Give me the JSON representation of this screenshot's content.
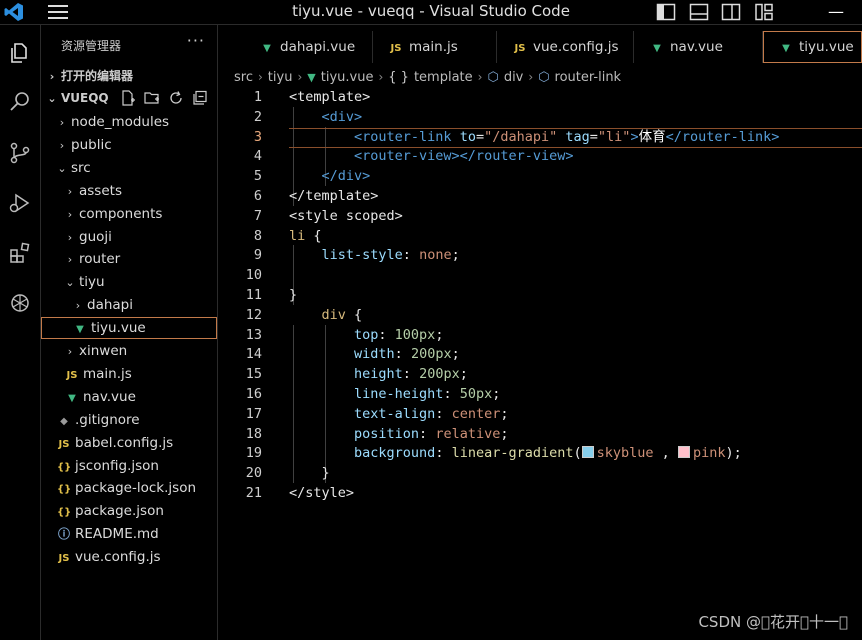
{
  "window": {
    "title": "tiyu.vue - vueqq - Visual Studio Code",
    "minimize_glyph": "—"
  },
  "explorer": {
    "title": "资源管理器",
    "more": "···",
    "open_editors": "打开的编辑器",
    "project": "VUEQQ",
    "items": [
      {
        "label": "node_modules",
        "kind": "folder",
        "expanded": false,
        "depth": 0
      },
      {
        "label": "public",
        "kind": "folder",
        "expanded": false,
        "depth": 0
      },
      {
        "label": "src",
        "kind": "folder",
        "expanded": true,
        "depth": 0
      },
      {
        "label": "assets",
        "kind": "folder",
        "expanded": false,
        "depth": 1
      },
      {
        "label": "components",
        "kind": "folder",
        "expanded": false,
        "depth": 1
      },
      {
        "label": "guoji",
        "kind": "folder",
        "expanded": false,
        "depth": 1
      },
      {
        "label": "router",
        "kind": "folder",
        "expanded": false,
        "depth": 1
      },
      {
        "label": "tiyu",
        "kind": "folder",
        "expanded": true,
        "depth": 1
      },
      {
        "label": "dahapi",
        "kind": "folder",
        "expanded": false,
        "depth": 2
      },
      {
        "label": "tiyu.vue",
        "kind": "vue",
        "depth": 2,
        "selected": true
      },
      {
        "label": "xinwen",
        "kind": "folder",
        "expanded": false,
        "depth": 1
      },
      {
        "label": "main.js",
        "kind": "js",
        "depth": 1
      },
      {
        "label": "nav.vue",
        "kind": "vue",
        "depth": 1
      },
      {
        "label": ".gitignore",
        "kind": "git",
        "depth": 0
      },
      {
        "label": "babel.config.js",
        "kind": "js",
        "depth": 0
      },
      {
        "label": "jsconfig.json",
        "kind": "json",
        "depth": 0
      },
      {
        "label": "package-lock.json",
        "kind": "json",
        "depth": 0
      },
      {
        "label": "package.json",
        "kind": "json",
        "depth": 0
      },
      {
        "label": "README.md",
        "kind": "info",
        "depth": 0
      },
      {
        "label": "vue.config.js",
        "kind": "js",
        "depth": 0
      }
    ]
  },
  "tabs": [
    {
      "label": "dahapi.vue",
      "kind": "vue"
    },
    {
      "label": "main.js",
      "kind": "js"
    },
    {
      "label": "vue.config.js",
      "kind": "js"
    },
    {
      "label": "nav.vue",
      "kind": "vue"
    },
    {
      "label": "tiyu.vue",
      "kind": "vue",
      "active": true
    }
  ],
  "icon_glyphs": {
    "js": "JS",
    "json": "{}",
    "vue": "▼",
    "info": "ⓘ",
    "git": "◆",
    "chevron_right": "›",
    "chevron_down": "⌄"
  },
  "breadcrumbs": [
    "src",
    "tiyu",
    "tiyu.vue",
    "template",
    "div",
    "router-link"
  ],
  "breadcrumb_prefix": {
    "template": "{ }",
    "vue": "▼",
    "tag": "⬡"
  },
  "editor": {
    "active_line": 3,
    "colors": {
      "skyblue": "#87ceeb",
      "pink": "#ffc0cb"
    },
    "lines": [
      [
        [
          "tagw",
          "<template>"
        ]
      ],
      [
        [
          "tag",
          "    <div>"
        ]
      ],
      [
        [
          "tag",
          "        <router-link "
        ],
        [
          "attr",
          "to"
        ],
        [
          "tagw",
          "="
        ],
        [
          "str",
          "\"/dahapi\""
        ],
        [
          "tag",
          " "
        ],
        [
          "attr",
          "tag"
        ],
        [
          "tagw",
          "="
        ],
        [
          "str",
          "\"li\""
        ],
        [
          "tag",
          ">"
        ],
        [
          "txt",
          "体育"
        ],
        [
          "tag",
          "</router-link>"
        ]
      ],
      [
        [
          "tag",
          "        <router-view></router-view>"
        ]
      ],
      [
        [
          "tag",
          "    </div>"
        ]
      ],
      [
        [
          "tagw",
          "</template>"
        ]
      ],
      [
        [
          "tagw",
          "<style scoped>"
        ]
      ],
      [
        [
          "sel",
          "li"
        ],
        [
          "tagw",
          " {"
        ]
      ],
      [
        [
          "prop",
          "    list-style"
        ],
        [
          "tagw",
          ": "
        ],
        [
          "val",
          "none"
        ],
        [
          "tagw",
          ";"
        ]
      ],
      [
        [
          "tagw",
          ""
        ]
      ],
      [
        [
          "tagw",
          "}"
        ]
      ],
      [
        [
          "sel",
          "    div"
        ],
        [
          "tagw",
          " {"
        ]
      ],
      [
        [
          "prop",
          "        top"
        ],
        [
          "tagw",
          ": "
        ],
        [
          "num",
          "100px"
        ],
        [
          "tagw",
          ";"
        ]
      ],
      [
        [
          "prop",
          "        width"
        ],
        [
          "tagw",
          ": "
        ],
        [
          "num",
          "200px"
        ],
        [
          "tagw",
          ";"
        ]
      ],
      [
        [
          "prop",
          "        height"
        ],
        [
          "tagw",
          ": "
        ],
        [
          "num",
          "200px"
        ],
        [
          "tagw",
          ";"
        ]
      ],
      [
        [
          "prop",
          "        line-height"
        ],
        [
          "tagw",
          ": "
        ],
        [
          "num",
          "50px"
        ],
        [
          "tagw",
          ";"
        ]
      ],
      [
        [
          "prop",
          "        text-align"
        ],
        [
          "tagw",
          ": "
        ],
        [
          "val",
          "center"
        ],
        [
          "tagw",
          ";"
        ]
      ],
      [
        [
          "prop",
          "        position"
        ],
        [
          "tagw",
          ": "
        ],
        [
          "val",
          "relative"
        ],
        [
          "tagw",
          ";"
        ]
      ],
      [
        [
          "prop",
          "        background"
        ],
        [
          "tagw",
          ": "
        ],
        [
          "fn",
          "linear-gradient"
        ],
        [
          "tagw",
          "("
        ],
        [
          "swatch:skyblue",
          ""
        ],
        [
          "val",
          "skyblue"
        ],
        [
          "tagw",
          " , "
        ],
        [
          "swatch:pink",
          ""
        ],
        [
          "val",
          "pink"
        ],
        [
          "tagw",
          ");"
        ]
      ],
      [
        [
          "tagw",
          "    }"
        ]
      ],
      [
        [
          "tagw",
          "</style>"
        ]
      ]
    ]
  },
  "watermark": "CSDN @\u0000花开\u0000十一\u0000"
}
